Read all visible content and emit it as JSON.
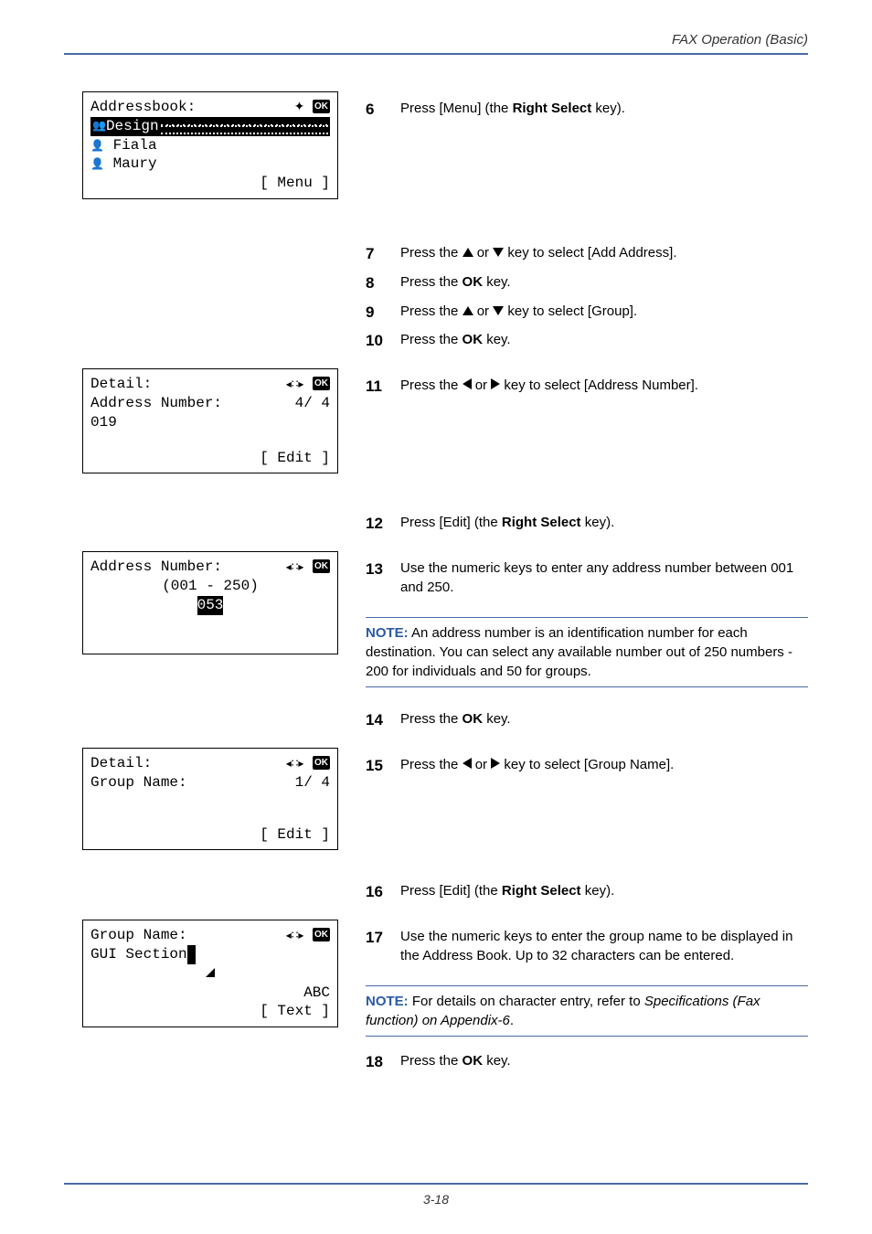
{
  "header": {
    "title": "FAX Operation (Basic)"
  },
  "footer": {
    "page": "3-18"
  },
  "screens": {
    "addrbook": {
      "title": "Addressbook:",
      "sel": "Design",
      "r2": "Fiala",
      "r3": "Maury",
      "softkey": "[  Menu  ]"
    },
    "detail1": {
      "title": "Detail:",
      "line2a": "Address Number:",
      "line2b": "4/ 4",
      "line3": "019",
      "softkey": "[  Edit  ]"
    },
    "addrnum": {
      "title": "Address Number:",
      "range": "(001 - 250)",
      "entry_pre": "   ",
      "entry_val": "053"
    },
    "detail2": {
      "title": "Detail:",
      "line2a": "Group Name:",
      "line2b": "1/ 4",
      "softkey": "[  Edit  ]"
    },
    "grpname": {
      "title": "Group Name:",
      "val": "GUI Section",
      "mode": "ABC",
      "softkey": "[  Text  ]"
    }
  },
  "steps": {
    "s6": {
      "n": "6",
      "a": "Press [Menu] (the ",
      "b": "Right Select",
      "c": " key)."
    },
    "s7": {
      "n": "7",
      "a": "Press the ",
      "b": " or ",
      "c": " key to select [Add Address]."
    },
    "s8": {
      "n": "8",
      "a": "Press the ",
      "b": "OK",
      "c": " key."
    },
    "s9": {
      "n": "9",
      "a": "Press the ",
      "b": " or ",
      "c": " key to select [Group]."
    },
    "s10": {
      "n": "10",
      "a": "Press the ",
      "b": "OK",
      "c": " key."
    },
    "s11": {
      "n": "11",
      "a": "Press the ",
      "b": " or ",
      "c": " key to select [Address Number]."
    },
    "s12": {
      "n": "12",
      "a": "Press [Edit] (the ",
      "b": "Right Select",
      "c": " key)."
    },
    "s13": {
      "n": "13",
      "a": "Use the numeric keys to enter any address number between 001 and 250."
    },
    "s14": {
      "n": "14",
      "a": "Press the ",
      "b": "OK",
      "c": " key."
    },
    "s15": {
      "n": "15",
      "a": "Press the ",
      "b": " or ",
      "c": " key to select [Group Name]."
    },
    "s16": {
      "n": "16",
      "a": "Press [Edit] (the ",
      "b": "Right Select",
      "c": " key)."
    },
    "s17": {
      "n": "17",
      "a": "Use the numeric keys to enter the group name to be displayed in the Address Book. Up to 32 characters can be entered."
    },
    "s18": {
      "n": "18",
      "a": "Press the ",
      "b": "OK",
      "c": " key."
    }
  },
  "notes": {
    "n1": {
      "label": "NOTE:",
      "text": " An address number is an identification number for each destination. You can select any available number out of 250 numbers - 200 for individuals and 50 for groups."
    },
    "n2": {
      "label": "NOTE:",
      "text1": " For details on character entry, refer to ",
      "em": "Specifications (Fax function) on Appendix-6",
      "text2": "."
    }
  }
}
